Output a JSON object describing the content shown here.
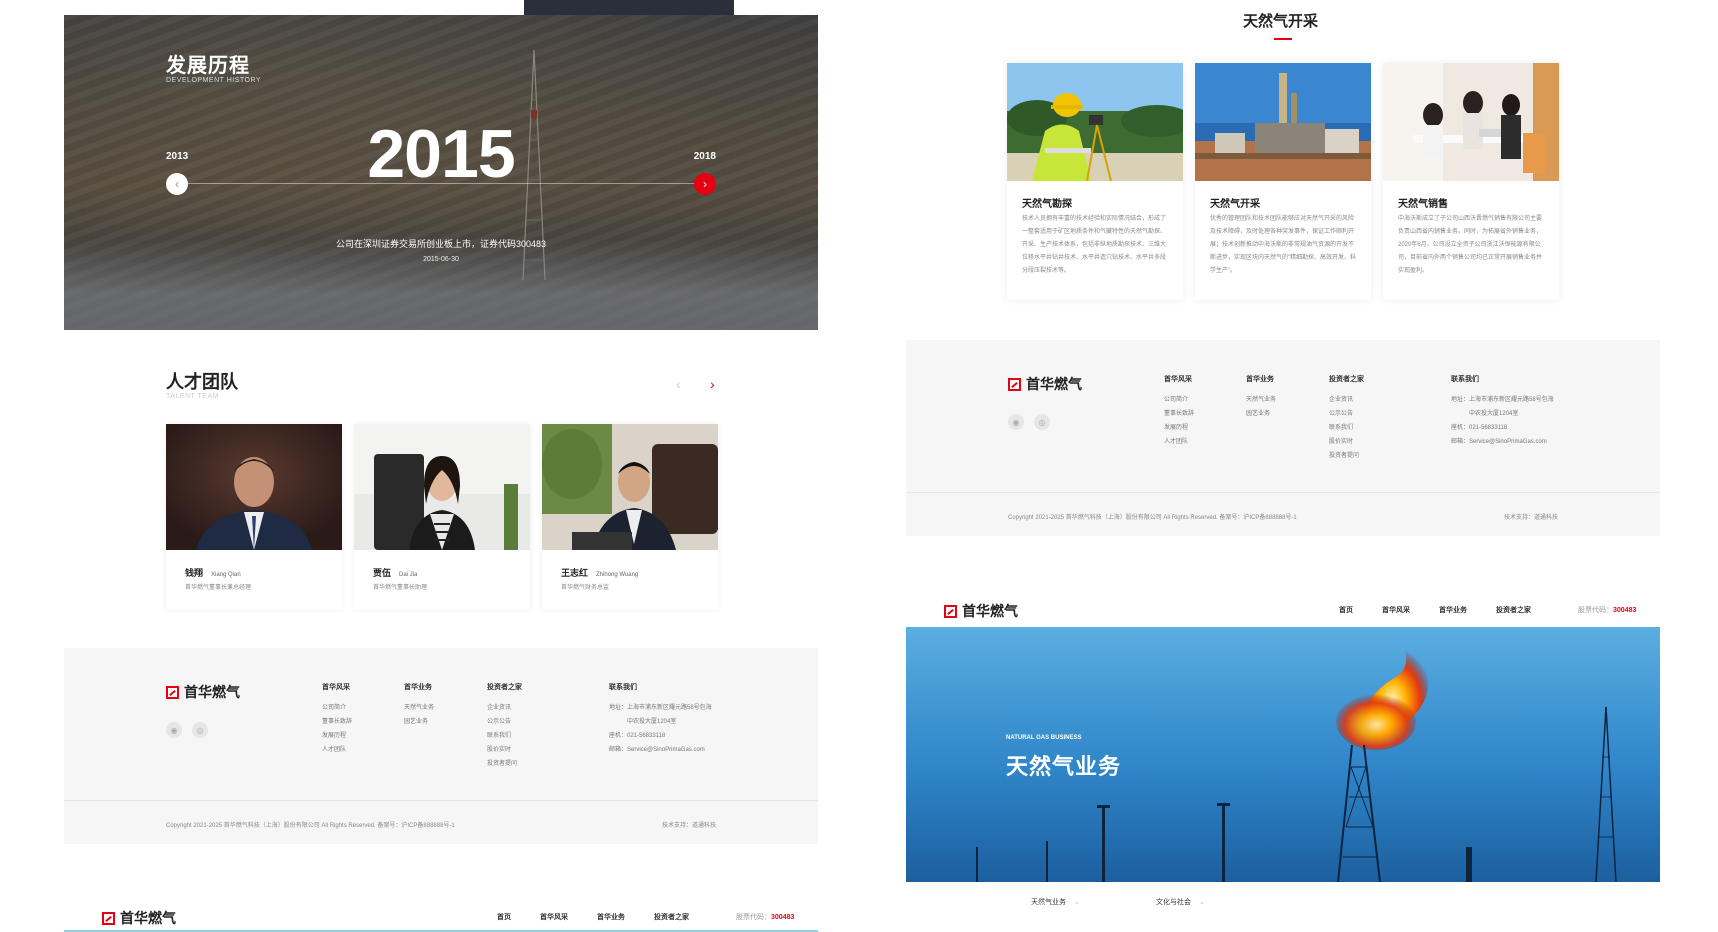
{
  "history": {
    "title": "发展历程",
    "subtitle": "DEVELOPMENT HISTORY",
    "prev_year": "2013",
    "current_year": "2015",
    "next_year": "2018",
    "description": "公司在深圳证券交易所创业板上市，证券代码300483",
    "date": "2015-06-30"
  },
  "team": {
    "title": "人才团队",
    "subtitle": "TALENT TEAM",
    "members": [
      {
        "name": "钱翔",
        "en": "Xiang Qian",
        "position": "首华燃气董事长兼总经理"
      },
      {
        "name": "贾伍",
        "en": "Dai Jia",
        "position": "首华燃气董事长助理"
      },
      {
        "name": "王志红",
        "en": "Zhihong Wuang",
        "position": "首华燃气财务总监"
      }
    ]
  },
  "footer": {
    "logo_text": "首华燃气",
    "columns": [
      {
        "heading": "首华风采",
        "items": [
          "公司简介",
          "董事长致辞",
          "发展历程",
          "人才团队"
        ]
      },
      {
        "heading": "首华业务",
        "items": [
          "天然气业务",
          "园艺业务"
        ]
      },
      {
        "heading": "投资者之家",
        "items": [
          "企业资讯",
          "公示公告",
          "联系我们",
          "股价实时",
          "投资者提问"
        ]
      }
    ],
    "contact": {
      "heading": "联系我们",
      "address_1": "地址：上海市浦东新区耀元路58号包海",
      "address_2": "中农投大厦1204室",
      "phone": "座机：021-56833118",
      "email": "邮箱：Service@SinoPrimaGas.com"
    },
    "copyright": "Copyright 2021-2025 首华燃气科技（上海）股份有限公司 All Rights Reserved.  备案号：沪ICP备888888号-1",
    "tech_support": "技术支持：道通科技"
  },
  "nav": {
    "logo_text": "首华燃气",
    "items": [
      "首页",
      "首华风采",
      "首华业务",
      "投资者之家"
    ],
    "stock_label": "股票代码：",
    "stock_code": "300483"
  },
  "gas": {
    "title": "天然气开采",
    "cards": [
      {
        "title": "天然气勘探",
        "text": "技术人员拥有丰富的技术经验和实际情况结合，形成了一整套适用于矿区地质条件和气藏特性的天然气勘探、开采、生产技术体系，包括非纵地质勘探技术、三维大位移水平井钻井技术、水平井造穴钻技术、水平井多段分段压裂技术等。"
      },
      {
        "title": "天然气开采",
        "text": "优秀的管理团队和技术团队能够应对天然气开采的风险及技术障碍，及时处理各种突发事件，保证工作顺利开展；技术创新推动中海沃斯的非常规油气资源的开发不断进步，实现区块内天然气的“精细勘探、高效开发、科学生产”。"
      },
      {
        "title": "天然气销售",
        "text": "中海沃斯成立了子公司山西沃晋燃气销售有限公司主要负责山西省内销售业务。同时，为拓展省外销售业务，2020年6月，公司设立全资子公司浙江沃恒能源有限公司，目前省内外两个销售公司均已正常开展销售业务并实现盈利。"
      }
    ]
  },
  "hero": {
    "tag": "NATURAL GAS BUSINESS",
    "title": "天然气业务",
    "subnav": [
      "天然气业务",
      "文化与社会"
    ]
  }
}
